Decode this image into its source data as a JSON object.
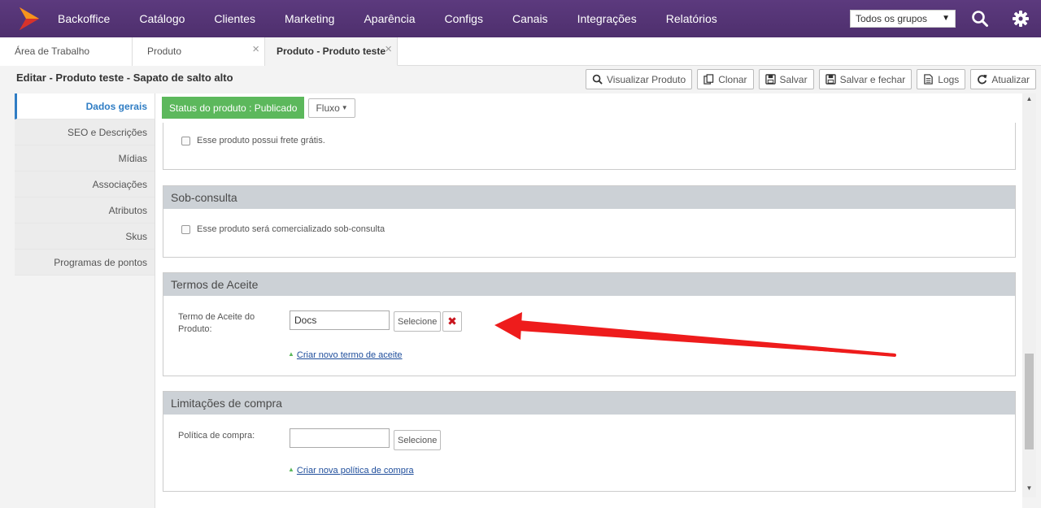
{
  "nav": {
    "items": [
      "Backoffice",
      "Catálogo",
      "Clientes",
      "Marketing",
      "Aparência",
      "Configs",
      "Canais",
      "Integrações",
      "Relatórios"
    ],
    "group_select": "Todos os grupos"
  },
  "tabs": [
    {
      "label": "Área de Trabalho"
    },
    {
      "label": "Produto"
    },
    {
      "label": "Produto - Produto teste"
    }
  ],
  "page": {
    "title": "Editar - Produto teste - Sapato de salto alto"
  },
  "toolbar": {
    "view": "Visualizar Produto",
    "clone": "Clonar",
    "save": "Salvar",
    "save_close": "Salvar e fechar",
    "logs": "Logs",
    "refresh": "Atualizar"
  },
  "sidemenu": [
    "Dados gerais",
    "SEO e Descrições",
    "Mídias",
    "Associações",
    "Atributos",
    "Skus",
    "Programas de pontos"
  ],
  "status": {
    "badge": "Status do produto : Publicado",
    "fluxo": "Fluxo"
  },
  "frete": {
    "checkbox_label": "Esse produto possui frete grátis."
  },
  "sob_consulta": {
    "title": "Sob-consulta",
    "checkbox_label": "Esse produto será comercializado sob-consulta"
  },
  "termos": {
    "title": "Termos de Aceite",
    "field_label": "Termo de Aceite do Produto:",
    "field_value": "Docs",
    "select_label": "Selecione",
    "create_link": "Criar novo termo de aceite"
  },
  "limitacoes": {
    "title": "Limitações de compra",
    "field_label": "Política de compra:",
    "field_value": "",
    "select_label": "Selecione",
    "create_link": "Criar nova política de compra"
  },
  "colors": {
    "nav_bg": "#553573",
    "status_green": "#5cb85c",
    "active_blue": "#2f7dc4",
    "panel_head": "#ccd1d6",
    "arrow_red": "#ee1c1c",
    "delete_red": "#c9151e"
  }
}
